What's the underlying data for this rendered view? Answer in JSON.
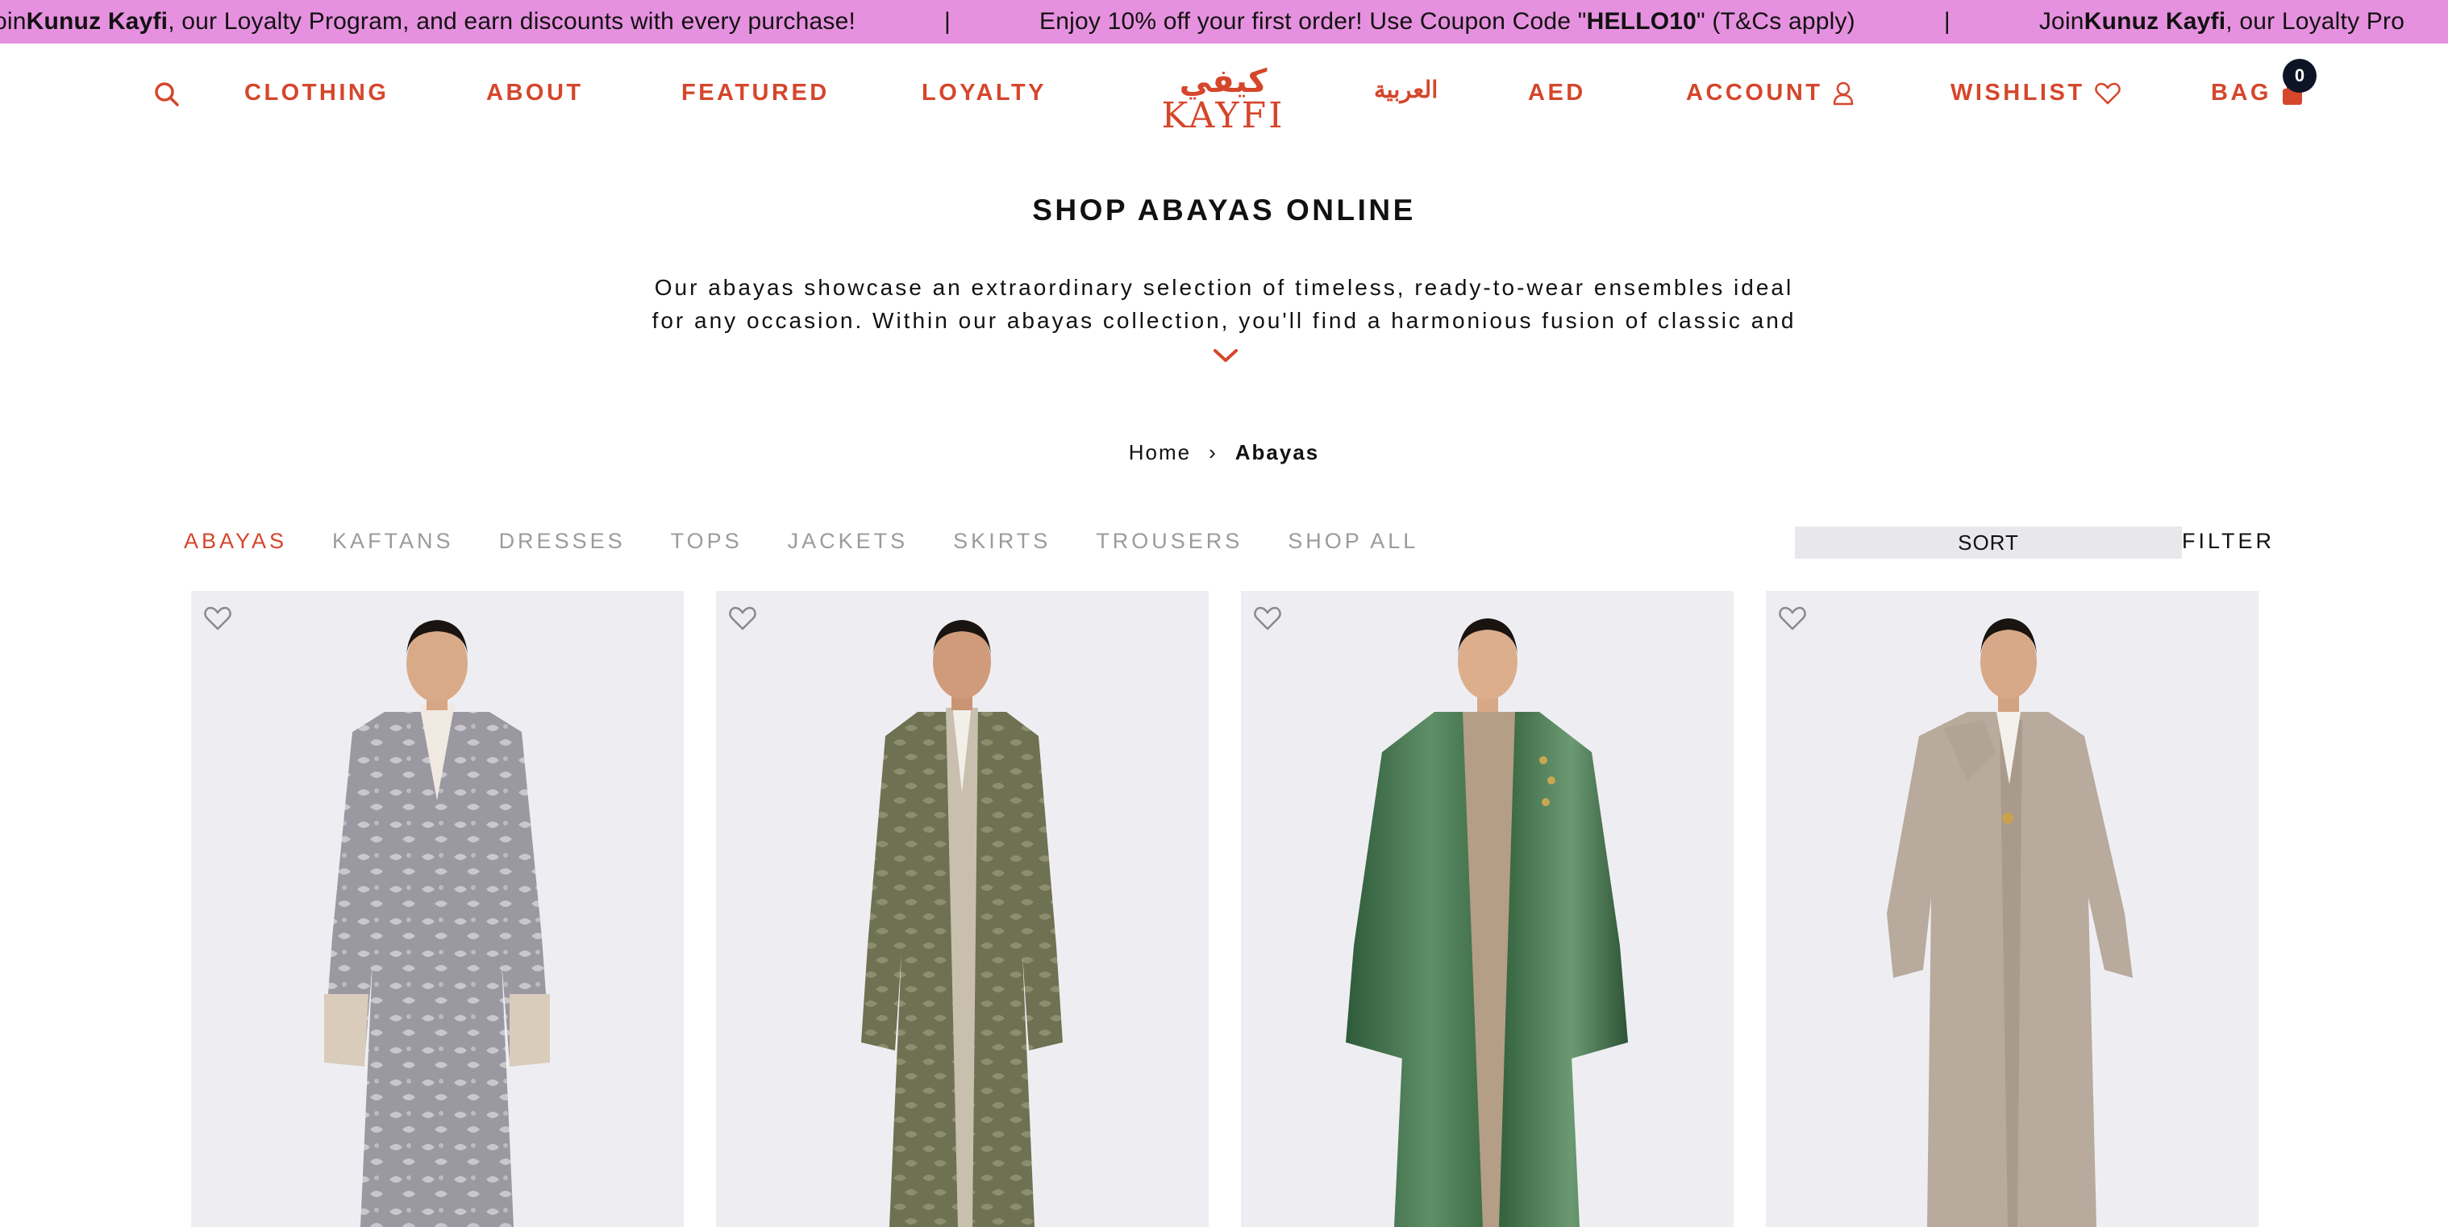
{
  "announcement": {
    "items": [
      {
        "prefix": "oin ",
        "bold": "Kunuz Kayfi",
        "suffix": ", our Loyalty Program, and earn discounts with every purchase!"
      },
      {
        "prefix": "Enjoy 10% off your first order! Use Coupon Code \"",
        "bold": "HELLO10",
        "suffix": "\" (T&Cs apply)"
      },
      {
        "prefix": "Join ",
        "bold": "Kunuz Kayfi",
        "suffix": ", our Loyalty Pro"
      }
    ],
    "separator": "|",
    "colors": {
      "background": "#e691df",
      "text": "#111111"
    }
  },
  "header": {
    "search_icon": "search-icon",
    "nav_left": [
      "CLOTHING",
      "ABOUT",
      "FEATURED",
      "LOYALTY"
    ],
    "logo": {
      "arabic": "كيفي",
      "latin": "KAYFI"
    },
    "language": "العربية",
    "currency": "AED",
    "account_label": "ACCOUNT",
    "account_icon": "user-icon",
    "wishlist_label": "WISHLIST",
    "wishlist_icon": "heart-icon",
    "bag_label": "BAG",
    "bag_icon": "shopping-bag-icon",
    "bag_count": "0",
    "accent_color": "#d5462b"
  },
  "intro": {
    "title": "SHOP ABAYAS ONLINE",
    "description_line1": "Our abayas showcase an extraordinary selection of timeless, ready-to-wear ensembles ideal",
    "description_line2": "for any occasion. Within our abayas collection, you'll find a harmonious fusion of classic and",
    "expand_icon": "chevron-down-icon"
  },
  "breadcrumb": {
    "home": "Home",
    "separator": "›",
    "current": "Abayas"
  },
  "categories": {
    "tabs": [
      "ABAYAS",
      "KAFTANS",
      "DRESSES",
      "TOPS",
      "JACKETS",
      "SKIRTS",
      "TROUSERS",
      "SHOP ALL"
    ],
    "active": "ABAYAS",
    "sort_label": "SORT",
    "filter_label": "FILTER"
  },
  "products": [
    {
      "image": "grey-floral-jacquard-abaya",
      "wishlist_icon": "heart-outline-icon"
    },
    {
      "image": "olive-printed-abaya",
      "wishlist_icon": "heart-outline-icon"
    },
    {
      "image": "green-satin-abaya",
      "wishlist_icon": "heart-outline-icon"
    },
    {
      "image": "beige-classic-abaya",
      "wishlist_icon": "heart-outline-icon"
    }
  ]
}
